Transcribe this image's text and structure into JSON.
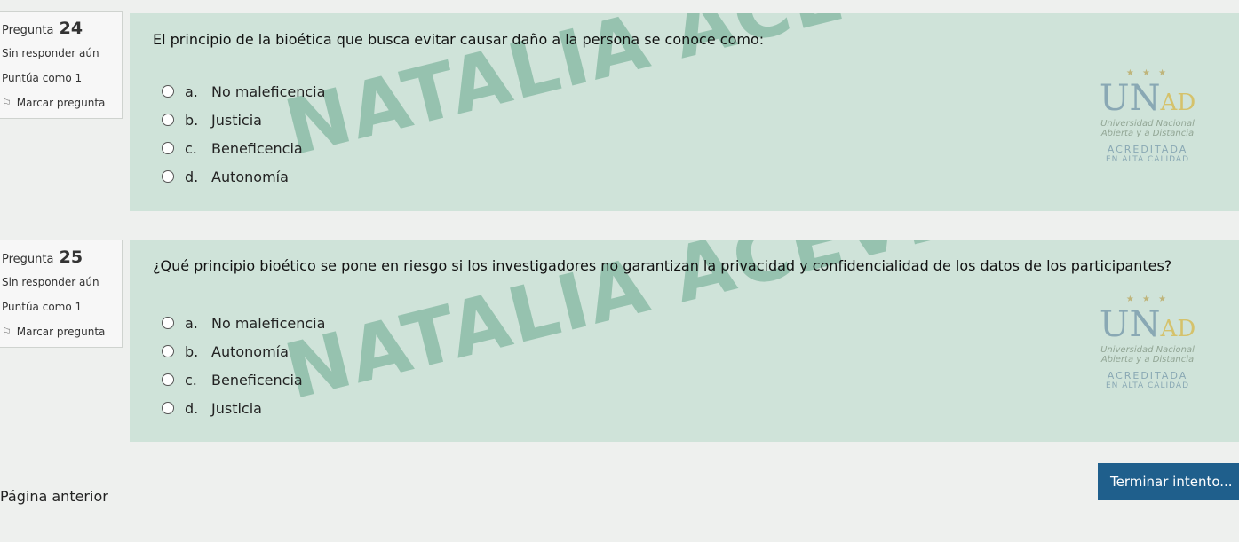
{
  "questions": [
    {
      "label": "Pregunta",
      "number": "24",
      "state": "Sin responder aún",
      "grade": "Puntúa como 1",
      "flag_label": "Marcar pregunta",
      "text": "El principio de la bioética que busca evitar causar daño a la persona se conoce como:",
      "options": [
        {
          "letter": "a.",
          "text": "No maleficencia"
        },
        {
          "letter": "b.",
          "text": "Justicia"
        },
        {
          "letter": "c.",
          "text": "Beneficencia"
        },
        {
          "letter": "d.",
          "text": "Autonomía"
        }
      ]
    },
    {
      "label": "Pregunta",
      "number": "25",
      "state": "Sin responder aún",
      "grade": "Puntúa como 1",
      "flag_label": "Marcar pregunta",
      "text": "¿Qué principio bioético se pone en riesgo si los investigadores no garantizan la privacidad y confidencialidad de los datos de los participantes?",
      "options": [
        {
          "letter": "a.",
          "text": "No maleficencia"
        },
        {
          "letter": "b.",
          "text": "Autonomía"
        },
        {
          "letter": "c.",
          "text": "Beneficencia"
        },
        {
          "letter": "d.",
          "text": "Justicia"
        }
      ]
    }
  ],
  "watermark": "NATALIA ACEVEDO VELEZ",
  "logo": {
    "mark_u": "UN",
    "mark_ad": "AD",
    "sub1": "Universidad Nacional",
    "sub2": "Abierta y a Distancia",
    "acc1": "ACREDITADA",
    "acc2": "EN ALTA CALIDAD"
  },
  "nav": {
    "prev_label": "Página anterior",
    "finish_label": "Terminar intento..."
  },
  "colors": {
    "panel": "#cfe3d9",
    "button": "#1f5f8c"
  }
}
